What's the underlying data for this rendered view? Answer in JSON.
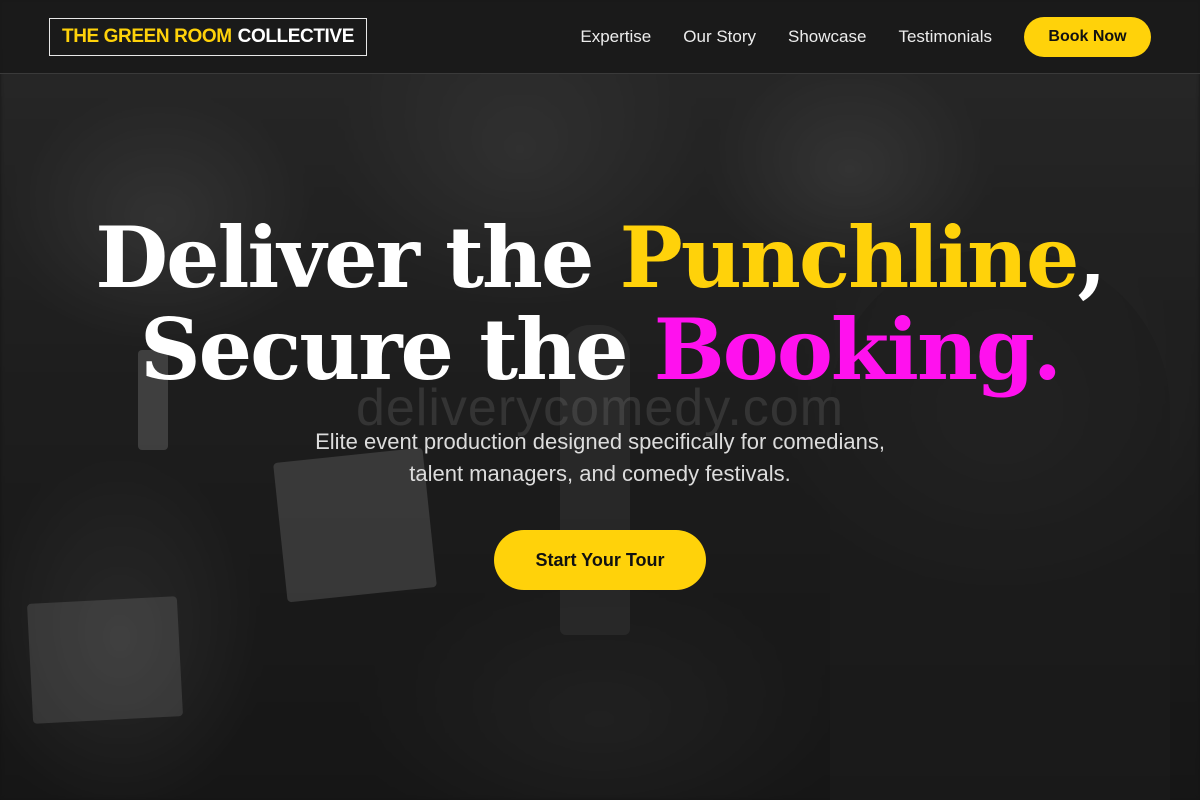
{
  "brand": {
    "logo_accent": "THE GREEN ROOM",
    "logo_rest": "COLLECTIVE"
  },
  "nav": {
    "links": [
      "Expertise",
      "Our Story",
      "Showcase",
      "Testimonials"
    ],
    "cta": "Book Now"
  },
  "hero": {
    "line1_start": "Deliver the ",
    "line1_highlight": "Punchline",
    "line1_end": ",",
    "line2_start": "Secure the ",
    "line2_highlight": "Booking.",
    "watermark": "deliverycomedy.com",
    "subtitle_line1": "Elite event production designed specifically for comedians,",
    "subtitle_line2": "talent managers, and comedy festivals.",
    "cta": "Start Your Tour"
  },
  "colors": {
    "accent_yellow": "#ffd20a",
    "accent_magenta": "#ff11ee",
    "header_bg": "#191919"
  }
}
